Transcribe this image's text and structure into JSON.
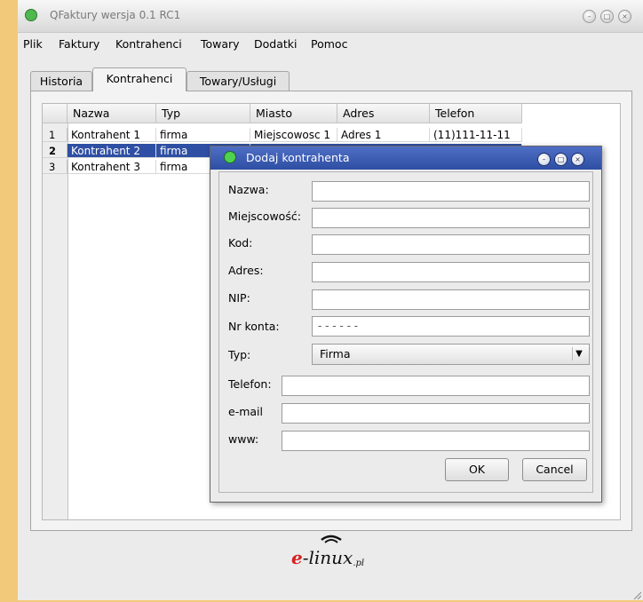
{
  "window": {
    "title": "QFaktury wersja 0.1 RC1"
  },
  "menu": [
    {
      "label": "Plik"
    },
    {
      "label": "Faktury"
    },
    {
      "label": "Kontrahenci"
    },
    {
      "label": "Towary"
    },
    {
      "label": "Dodatki"
    },
    {
      "label": "Pomoc"
    }
  ],
  "tabs": [
    {
      "label": "Historia"
    },
    {
      "label": "Kontrahenci"
    },
    {
      "label": "Towary/Usługi"
    }
  ],
  "table": {
    "columns": [
      "Nazwa",
      "Typ",
      "Miasto",
      "Adres",
      "Telefon"
    ],
    "rows": [
      {
        "num": "1",
        "nazwa": "Kontrahent 1",
        "typ": "firma",
        "miasto": "Miejscowosc 1",
        "adres": "Adres 1",
        "telefon": "(11)111-11-11"
      },
      {
        "num": "2",
        "nazwa": "Kontrahent 2",
        "typ": "firma"
      },
      {
        "num": "3",
        "nazwa": "Kontrahent 3",
        "typ": "firma"
      }
    ]
  },
  "logo": {
    "e": "e",
    "text": "-linux",
    "suffix": ".pl"
  },
  "dialog": {
    "title": "Dodaj kontrahenta",
    "labels": {
      "nazwa": "Nazwa:",
      "miejscowosc": "Miejscowość:",
      "kod": "Kod:",
      "adres": "Adres:",
      "nip": "NIP:",
      "nr_konta": "Nr konta:",
      "typ": "Typ:",
      "telefon": "Telefon:",
      "email": "e-mail",
      "www": "www:"
    },
    "values": {
      "nr_konta": "-  -  -  -  -  -",
      "typ": "Firma"
    },
    "ok_label": "OK",
    "cancel_label": "Cancel"
  },
  "colors": {
    "selection": "#2e4fa3",
    "desktop": "#f2c97a",
    "dialog_titlebar": "#2e4ea3"
  }
}
